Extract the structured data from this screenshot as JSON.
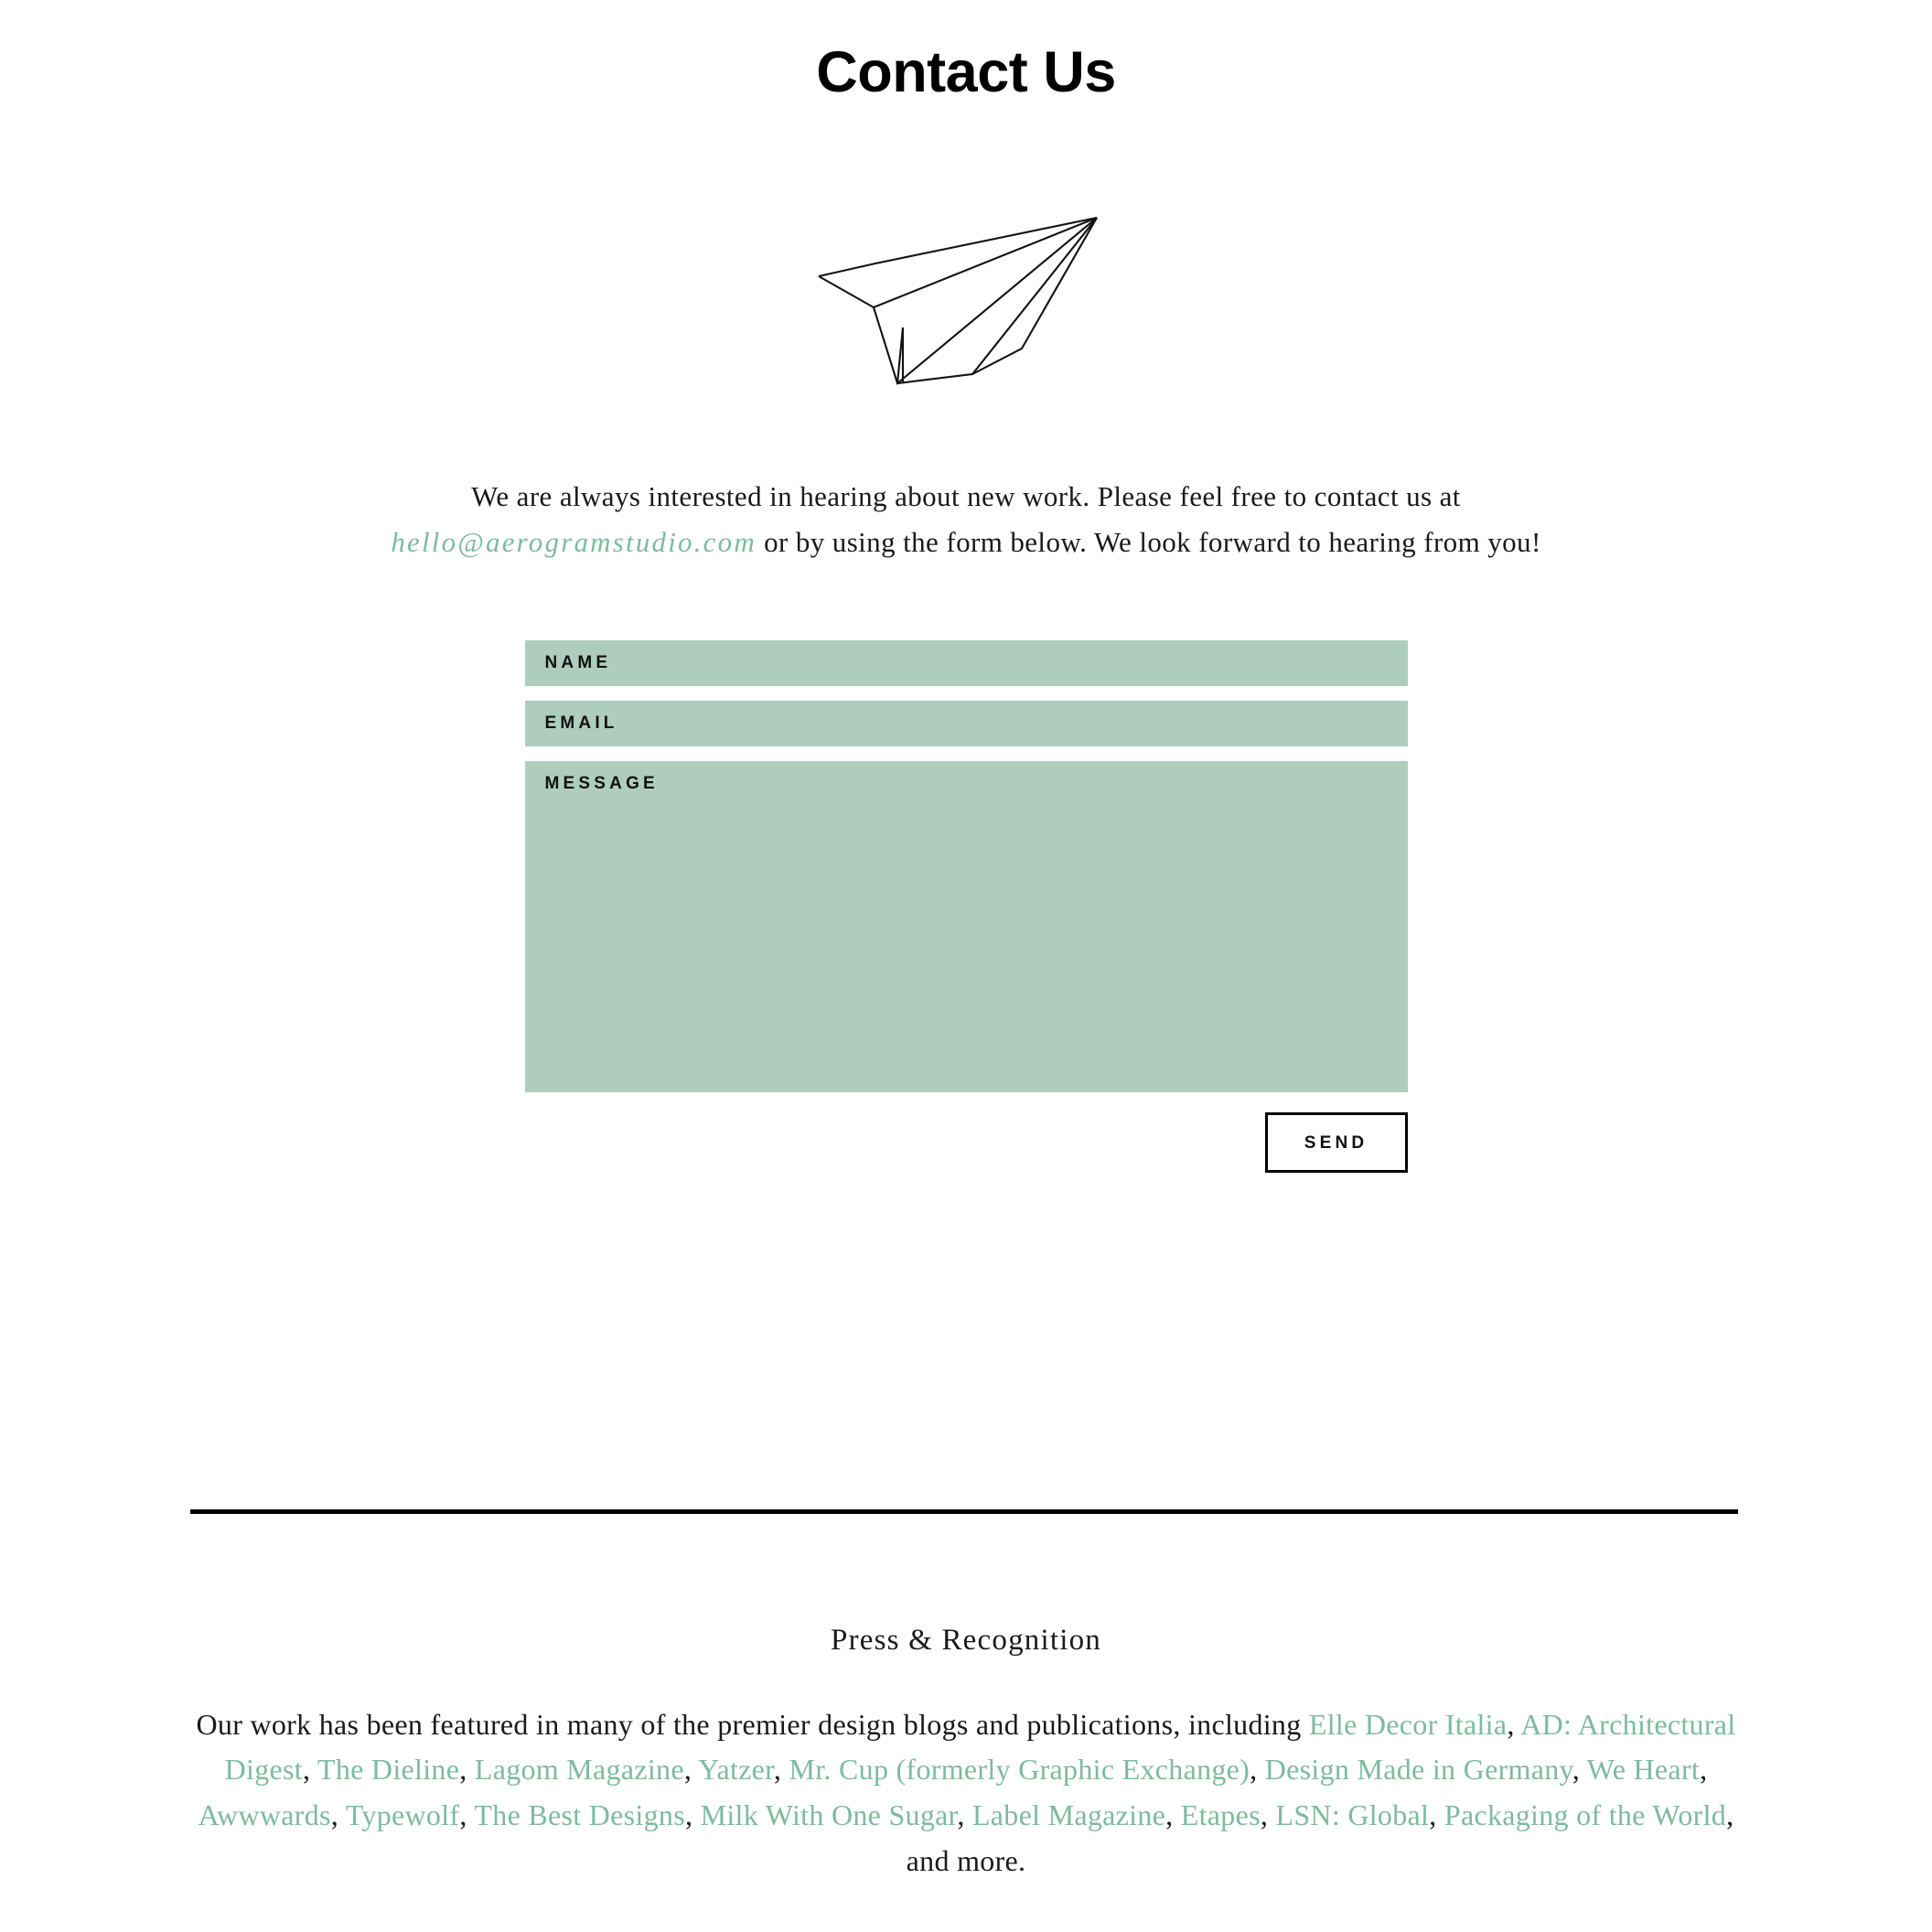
{
  "page": {
    "title": "Contact Us",
    "background_color": "#ffffff",
    "accent_green": "#7dbb9e",
    "field_green": "#aecdbd",
    "text_color": "#1a1a1a"
  },
  "illustration": {
    "name": "paper-airplane-line-drawing",
    "stroke_color": "#000000"
  },
  "intro": {
    "part_1": "We are always interested in hearing about new work. Please feel free to contact us at ",
    "email": "hello@aerogramstudio.com",
    "part_2": " or by using the form below. We look forward to hearing from you!"
  },
  "form": {
    "fields": [
      {
        "label": "NAME",
        "value": "",
        "placeholder": "",
        "type": "text"
      },
      {
        "label": "EMAIL",
        "value": "",
        "placeholder": "",
        "type": "text"
      },
      {
        "label": "MESSAGE",
        "value": "",
        "placeholder": "",
        "type": "textarea"
      }
    ],
    "submit_label": "SEND"
  },
  "press": {
    "heading": "Press & Recognition",
    "lead_text": "Our work has been featured in many of the premier design blogs and publications, including ",
    "links": [
      "Elle Decor Italia",
      "AD: Architectural Digest",
      "The Dieline",
      "Lagom Magazine",
      "Yatzer",
      "Mr. Cup (formerly Graphic Exchange)",
      "Design Made in Germany",
      "We Heart",
      "Awwwards",
      "Typewolf",
      "The Best Designs",
      "Milk With One Sugar",
      "Label Magazine",
      "Etapes",
      "LSN: Global",
      "Packaging of the World"
    ],
    "separator": ", ",
    "trailing_text": ", and more."
  }
}
